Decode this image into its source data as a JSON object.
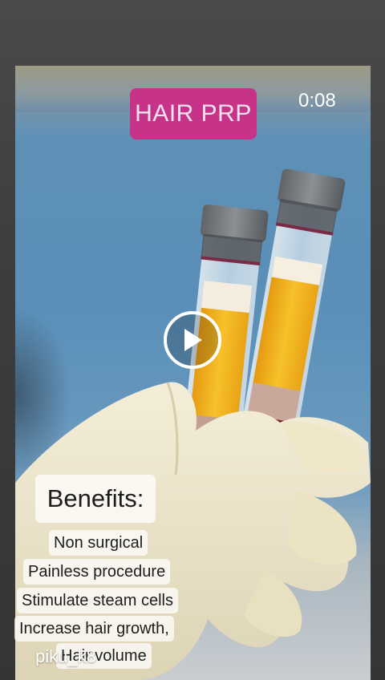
{
  "video": {
    "badge_text": "HAIR PRP",
    "elapsed_time": "0:08"
  },
  "overlay": {
    "benefits_title": "Benefits:",
    "benefits": [
      "Non surgical",
      "Painless procedure",
      "Stimulate steam cells",
      "Increase hair growth,",
      "Hair volume"
    ]
  },
  "author": {
    "username": "piku_k8"
  },
  "colors": {
    "badge_bg": "#c8338a",
    "plasma_yellow": "#f1b320",
    "glove": "#efe7cc",
    "tube_cap": "#6c7278"
  }
}
